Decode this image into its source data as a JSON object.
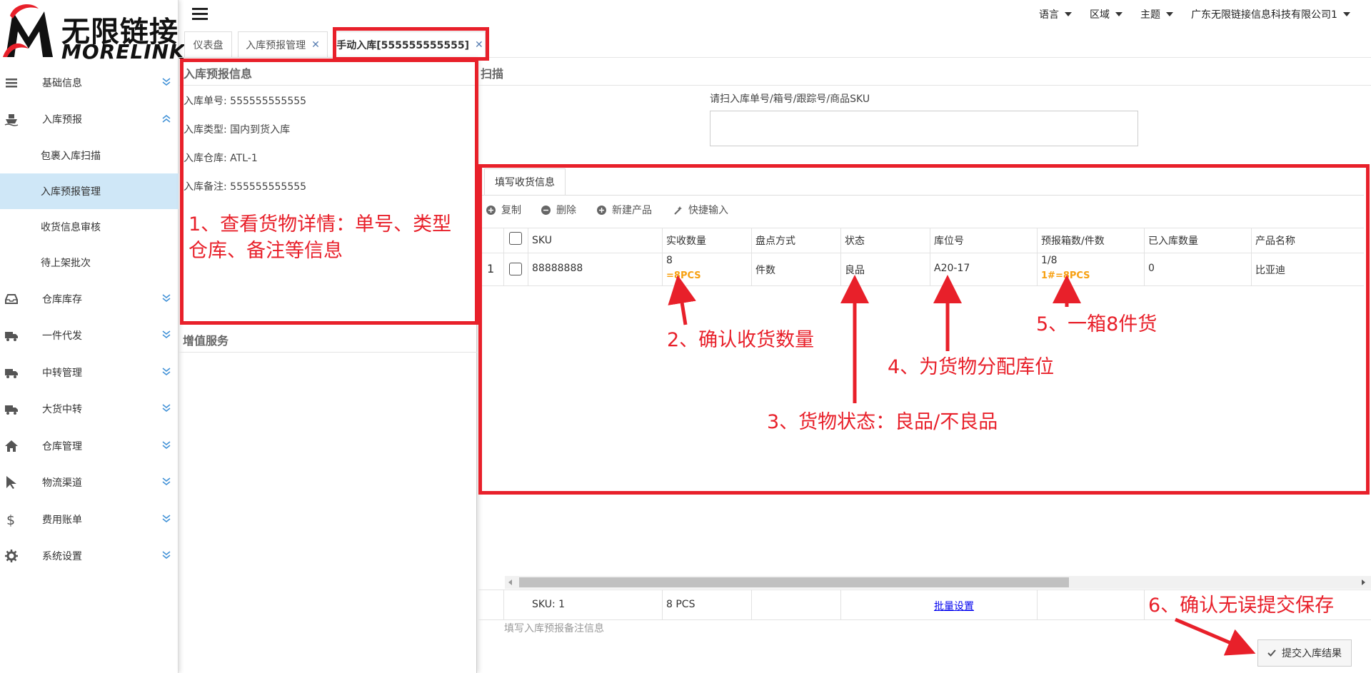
{
  "app": {
    "logo_cn": "无限链接",
    "logo_en": "MORELINK"
  },
  "sidebar": {
    "items": [
      {
        "label": "基础信息",
        "icon": "list-icon"
      },
      {
        "label": "入库预报",
        "icon": "ship-icon"
      },
      {
        "label": "仓库库存",
        "icon": "inbox-icon"
      },
      {
        "label": "一件代发",
        "icon": "truck-icon"
      },
      {
        "label": "中转管理",
        "icon": "truck-icon"
      },
      {
        "label": "大货中转",
        "icon": "truck-icon"
      },
      {
        "label": "仓库管理",
        "icon": "home-icon"
      },
      {
        "label": "物流渠道",
        "icon": "cursor-icon"
      },
      {
        "label": "费用账单",
        "icon": "dollar-icon"
      },
      {
        "label": "系统设置",
        "icon": "gear-icon"
      }
    ],
    "subitems": [
      {
        "label": "包裹入库扫描"
      },
      {
        "label": "入库预报管理"
      },
      {
        "label": "收货信息审核"
      },
      {
        "label": "待上架批次"
      }
    ]
  },
  "header": {
    "language": "语言",
    "region": "区域",
    "theme": "主题",
    "company": "广东无限链接信息科技有限公司1"
  },
  "tabs": [
    {
      "label": "仪表盘"
    },
    {
      "label": "入库预报管理"
    },
    {
      "label": "手动入库[555555555555]"
    }
  ],
  "left": {
    "title": "入库预报信息",
    "order_no": "入库单号: 555555555555",
    "type": "入库类型: 国内到货入库",
    "warehouse": "入库仓库: ATL-1",
    "remark": "入库备注: 555555555555",
    "vas_title": "增值服务"
  },
  "scan": {
    "title": "扫描",
    "label": "请扫入库单号/箱号/跟踪号/商品SKU"
  },
  "grid": {
    "tab": "填写收货信息",
    "toolbar": [
      "复制",
      "删除",
      "新建产品",
      "快捷输入"
    ],
    "columns": [
      "SKU",
      "实收数量",
      "盘点方式",
      "状态",
      "库位号",
      "预报箱数/件数",
      "已入库数量",
      "产品名称"
    ],
    "rows": [
      {
        "index": "1",
        "sku": "88888888",
        "qty": "8",
        "qty_note": "=8PCS",
        "method": "件数",
        "status": "良品",
        "location": "A20-17",
        "forecast": "1/8",
        "forecast_note": "1#=8PCS",
        "received": "0",
        "product": "比亚迪"
      }
    ],
    "footer": {
      "sku_count": "SKU: 1",
      "pcs": "8 PCS",
      "batch_link": "批量设置"
    },
    "remark_placeholder": "填写入库预报备注信息"
  },
  "submit_label": "提交入库结果",
  "annotations": {
    "a1": "1、查看货物详情：单号、类型\n仓库、备注等信息",
    "a2": "2、确认收货数量",
    "a3": "3、货物状态：良品/不良品",
    "a4": "4、为货物分配库位",
    "a5": "5、一箱8件货",
    "a6": "6、确认无误提交保存"
  },
  "colors": {
    "annotation_red": "#e8202a",
    "highlight_orange": "#f7a011",
    "active_nav_bg": "#cfe7f7",
    "chevron_blue": "#3d8fd6"
  }
}
